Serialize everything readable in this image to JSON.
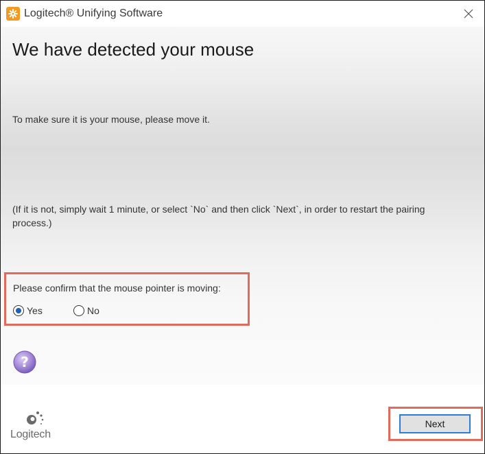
{
  "window": {
    "title": "Logitech® Unifying Software"
  },
  "main": {
    "heading": "We have detected your mouse",
    "instruction": "To make sure it is your mouse, please move it.",
    "note": "(If it is not, simply wait 1 minute, or select `No` and then click `Next`, in order to restart the pairing process.)"
  },
  "confirm": {
    "label": "Please confirm that the mouse pointer is moving:",
    "options": [
      {
        "label": "Yes",
        "selected": true
      },
      {
        "label": "No",
        "selected": false
      }
    ]
  },
  "footer": {
    "logo_text": "Logitech",
    "next_label": "Next"
  },
  "colors": {
    "accent": "#f39a1f",
    "highlight": "#e06a5c",
    "focus": "#2d7cd6",
    "help": "#a78bd8"
  }
}
